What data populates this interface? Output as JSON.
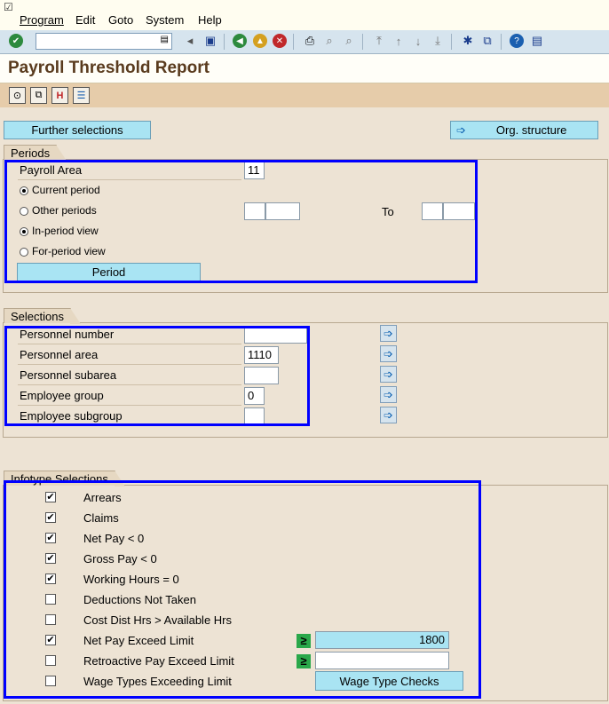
{
  "menu": [
    "Program",
    "Edit",
    "Goto",
    "System",
    "Help"
  ],
  "title": "Payroll Threshold Report",
  "buttons": {
    "further_selections": "Further selections",
    "org_structure": "Org. structure",
    "period": "Period",
    "wage_type_checks": "Wage Type Checks"
  },
  "periods": {
    "tab": "Periods",
    "payroll_area_label": "Payroll Area",
    "payroll_area_value": "11",
    "current_period": "Current period",
    "other_periods": "Other periods",
    "to_label": "To",
    "in_period_view": "In-period view",
    "for_period_view": "For-period view"
  },
  "selections": {
    "tab": "Selections",
    "rows": [
      {
        "label": "Personnel number",
        "value": ""
      },
      {
        "label": "Personnel area",
        "value": "1110"
      },
      {
        "label": "Personnel subarea",
        "value": ""
      },
      {
        "label": "Employee group",
        "value": "0"
      },
      {
        "label": "Employee subgroup",
        "value": ""
      }
    ]
  },
  "infotype": {
    "tab": "Infotype Selections",
    "items": [
      {
        "label": "Arrears",
        "checked": true
      },
      {
        "label": "Claims",
        "checked": true
      },
      {
        "label": "Net Pay < 0",
        "checked": true
      },
      {
        "label": "Gross Pay < 0",
        "checked": true
      },
      {
        "label": "Working Hours = 0",
        "checked": true
      },
      {
        "label": "Deductions Not Taken",
        "checked": false
      },
      {
        "label": "Cost Dist Hrs > Available Hrs",
        "checked": false
      },
      {
        "label": "Net Pay Exceed Limit",
        "checked": true
      },
      {
        "label": "Retroactive Pay Exceed Limit",
        "checked": false
      },
      {
        "label": "Wage Types Exceeding Limit",
        "checked": false
      }
    ],
    "net_pay_limit": "1800",
    "retro_limit": ""
  },
  "colors": {
    "highlight": "#0000ff",
    "button": "#a9e4f3"
  }
}
